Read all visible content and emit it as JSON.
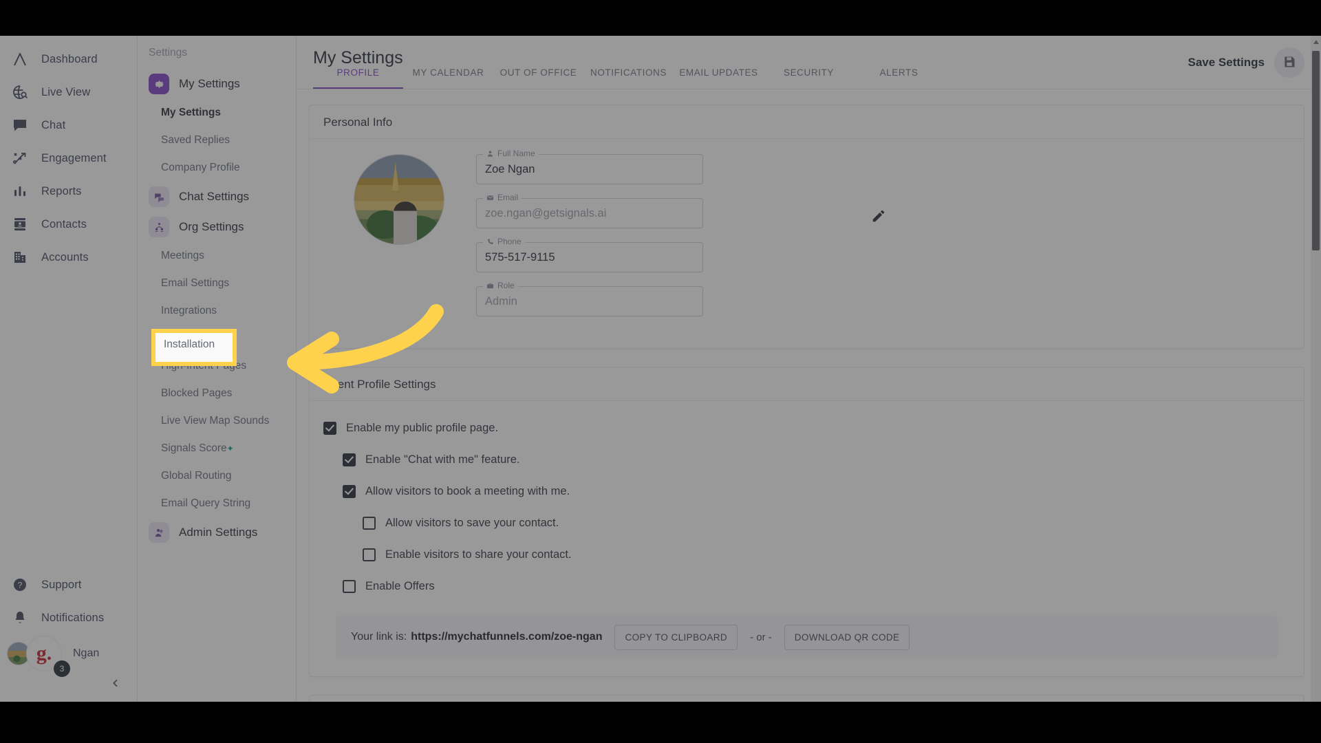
{
  "rail": {
    "items": [
      {
        "label": "Dashboard",
        "icon": "logo-a-icon"
      },
      {
        "label": "Live View",
        "icon": "globe-search-icon"
      },
      {
        "label": "Chat",
        "icon": "chat-bubble-icon"
      },
      {
        "label": "Engagement",
        "icon": "engagement-arrow-icon"
      },
      {
        "label": "Reports",
        "icon": "bar-chart-icon"
      },
      {
        "label": "Contacts",
        "icon": "contact-card-icon"
      },
      {
        "label": "Accounts",
        "icon": "building-icon"
      }
    ],
    "bottom": [
      {
        "label": "Support",
        "icon": "help-circle-icon"
      },
      {
        "label": "Notifications",
        "icon": "bell-icon"
      }
    ],
    "user": {
      "name": "Ngan",
      "badge_letter": "g.",
      "notification_count": "3"
    }
  },
  "subnav": {
    "title": "Settings",
    "groups": [
      {
        "label": "My Settings",
        "icon": "gear-icon",
        "active": true,
        "items": [
          {
            "label": "My Settings",
            "current": true
          },
          {
            "label": "Saved Replies",
            "current": false
          },
          {
            "label": "Company Profile",
            "current": false
          }
        ]
      },
      {
        "label": "Chat Settings",
        "icon": "chat-settings-icon",
        "active": false,
        "items": []
      },
      {
        "label": "Org Settings",
        "icon": "org-people-icon",
        "active": false,
        "items": [
          {
            "label": "Meetings",
            "current": false
          },
          {
            "label": "Email Settings",
            "current": false
          },
          {
            "label": "Integrations",
            "current": false
          },
          {
            "label": "Installation",
            "current": false
          },
          {
            "label": "High-Intent Pages",
            "current": false
          },
          {
            "label": "Blocked Pages",
            "current": false
          },
          {
            "label": "Live View Map Sounds",
            "current": false
          },
          {
            "label": "Signals Score",
            "current": false,
            "star": "✦"
          },
          {
            "label": "Global Routing",
            "current": false
          },
          {
            "label": "Email Query String",
            "current": false
          }
        ]
      },
      {
        "label": "Admin Settings",
        "icon": "admin-icon",
        "active": false,
        "items": []
      }
    ]
  },
  "highlight": {
    "target_label": "Installation",
    "box_color": "#ffd24d",
    "arrow_color": "#ffd24d"
  },
  "header": {
    "title": "My Settings",
    "save_label": "Save Settings",
    "save_icon": "floppy-disk-icon",
    "tabs": [
      {
        "label": "PROFILE",
        "active": true
      },
      {
        "label": "MY CALENDAR",
        "active": false
      },
      {
        "label": "OUT OF OFFICE",
        "active": false
      },
      {
        "label": "NOTIFICATIONS",
        "active": false
      },
      {
        "label": "EMAIL UPDATES",
        "active": false
      },
      {
        "label": "SECURITY",
        "active": false
      },
      {
        "label": "ALERTS",
        "active": false
      }
    ]
  },
  "personal_info": {
    "card_title": "Personal Info",
    "avatar_alt": "user-profile-photo",
    "edit_icon": "pencil-icon",
    "fields": [
      {
        "legend": "Full Name",
        "icon": "person-icon",
        "value": "Zoe Ngan",
        "muted": false
      },
      {
        "legend": "Email",
        "icon": "envelope-icon",
        "value": "zoe.ngan@getsignals.ai",
        "muted": true
      },
      {
        "legend": "Phone",
        "icon": "phone-icon",
        "value": "575-517-9115",
        "muted": false
      },
      {
        "legend": "Role",
        "icon": "briefcase-icon",
        "value": "Admin",
        "muted": true
      }
    ]
  },
  "agent_profile": {
    "card_title": "Agent Profile Settings",
    "checkboxes": [
      {
        "label": "Enable my public profile page.",
        "checked": true,
        "indent": 0
      },
      {
        "label": "Enable \"Chat with me\" feature.",
        "checked": true,
        "indent": 1
      },
      {
        "label": "Allow visitors to book a meeting with me.",
        "checked": true,
        "indent": 1
      },
      {
        "label": "Allow visitors to save your contact.",
        "checked": false,
        "indent": 2
      },
      {
        "label": "Enable visitors to share your contact.",
        "checked": false,
        "indent": 2
      },
      {
        "label": "Enable Offers",
        "checked": false,
        "indent": 1
      }
    ],
    "link_prefix": "Your link is:",
    "link_url": "https://mychatfunnels.com/zoe-ngan",
    "copy_button": "COPY TO CLIPBOARD",
    "or_text": "- or -",
    "qr_button": "DOWNLOAD QR CODE"
  },
  "colors": {
    "accent_purple": "#7c3cc4",
    "highlight_yellow": "#ffd24d",
    "text_dark": "#1d222c",
    "text_muted": "#9a9aa4"
  }
}
